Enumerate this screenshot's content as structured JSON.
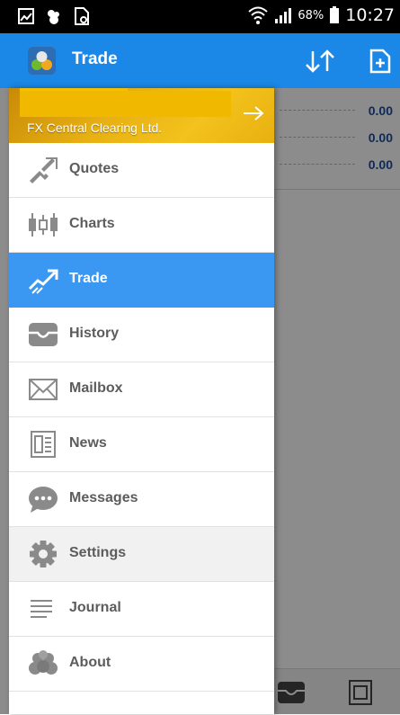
{
  "status_bar": {
    "battery_percent": "68%",
    "time": "10:27"
  },
  "app_bar": {
    "title": "Trade",
    "colors": {
      "background": "#1b87e6"
    }
  },
  "background_screen": {
    "values": [
      "0.00",
      "0.00",
      "0.00"
    ]
  },
  "drawer": {
    "account": {
      "name": "FX Central Clearing Ltd."
    },
    "items": [
      {
        "label": "Quotes",
        "icon": "quotes-icon",
        "active": false
      },
      {
        "label": "Charts",
        "icon": "charts-icon",
        "active": false
      },
      {
        "label": "Trade",
        "icon": "trade-icon",
        "active": true
      },
      {
        "label": "History",
        "icon": "history-icon",
        "active": false
      },
      {
        "label": "Mailbox",
        "icon": "mailbox-icon",
        "active": false
      },
      {
        "label": "News",
        "icon": "news-icon",
        "active": false
      },
      {
        "label": "Messages",
        "icon": "messages-icon",
        "active": false
      },
      {
        "label": "Settings",
        "icon": "settings-icon",
        "active": false
      },
      {
        "label": "Journal",
        "icon": "journal-icon",
        "active": false
      },
      {
        "label": "About",
        "icon": "about-icon",
        "active": false
      }
    ],
    "colors": {
      "active": "#3a97f2",
      "account_banner": "#e7b013"
    }
  }
}
